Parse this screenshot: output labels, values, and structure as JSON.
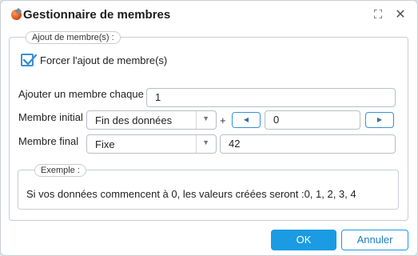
{
  "window": {
    "title": "Gestionnaire de membres"
  },
  "group": {
    "legend": "Ajout de membre(s) :",
    "force_checkbox": {
      "label": "Forcer l'ajout de membre(s)",
      "checked": true
    },
    "add_each": {
      "label": "Ajouter un membre chaque",
      "value": "1"
    },
    "initial": {
      "label": "Membre initial",
      "select_value": "Fin des données",
      "plus": "+",
      "value": "0"
    },
    "final": {
      "label": "Membre final",
      "select_value": "Fixe",
      "value": "42"
    },
    "example": {
      "legend": "Exemple :",
      "text": "Si vos données commencent à 0, les valeurs créées seront :0, 1, 2, 3, 4"
    }
  },
  "buttons": {
    "ok": "OK",
    "cancel": "Annuler"
  },
  "colors": {
    "accent": "#1a9be3",
    "border": "#c8cdd4"
  }
}
